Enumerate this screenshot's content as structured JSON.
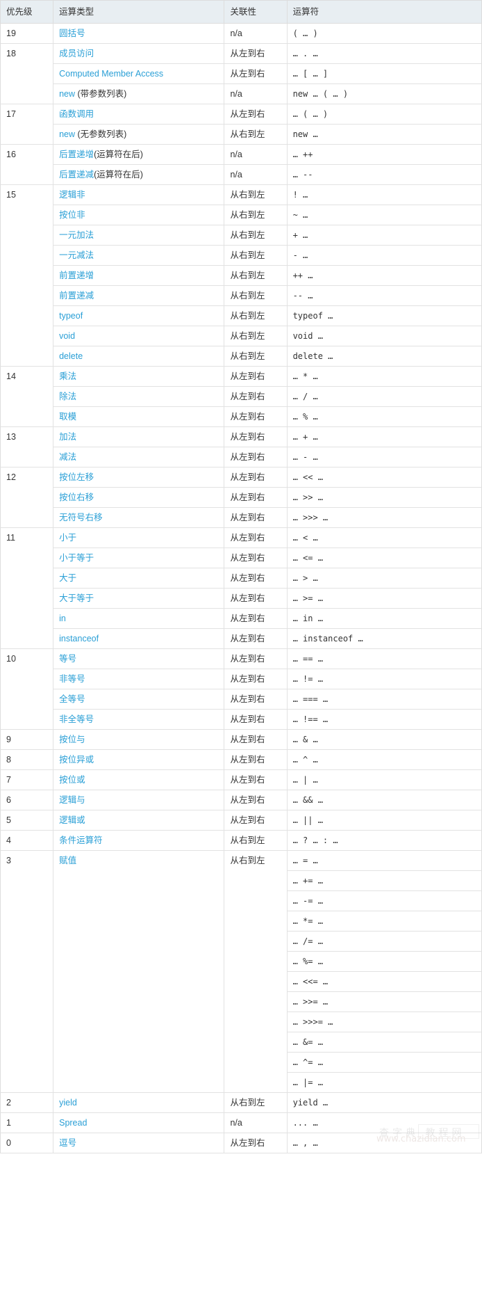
{
  "table": {
    "headers": [
      "优先级",
      "运算类型",
      "关联性",
      "运算符"
    ],
    "rows": [
      {
        "precedence": "19",
        "type_link": "圆括号",
        "type_plain": "",
        "assoc": "n/a",
        "operator": "( … )",
        "prec_rowspan": 1,
        "prec_show": true
      },
      {
        "precedence": "18",
        "type_link": "成员访问",
        "type_plain": "",
        "assoc": "从左到右",
        "operator": "… . …",
        "prec_rowspan": 3,
        "prec_show": true
      },
      {
        "precedence": "",
        "type_link": "Computed Member Access",
        "type_plain": "",
        "assoc": "从左到右",
        "operator": "… [ … ]",
        "prec_show": false
      },
      {
        "precedence": "",
        "type_link": "new",
        "type_plain": " (带参数列表)",
        "assoc": "n/a",
        "operator": "new … ( … )",
        "prec_show": false
      },
      {
        "precedence": "17",
        "type_link": "函数调用",
        "type_plain": "",
        "assoc": "从左到右",
        "operator": "… ( … )",
        "prec_rowspan": 2,
        "prec_show": true
      },
      {
        "precedence": "",
        "type_link": "new",
        "type_plain": " (无参数列表)",
        "assoc": "从右到左",
        "operator": "new …",
        "prec_show": false
      },
      {
        "precedence": "16",
        "type_link": "后置递增",
        "type_plain": "(运算符在后)",
        "assoc": "n/a",
        "operator": "… ++",
        "prec_rowspan": 2,
        "prec_show": true
      },
      {
        "precedence": "",
        "type_link": "后置递减",
        "type_plain": "(运算符在后)",
        "assoc": "n/a",
        "operator": "… --",
        "prec_show": false
      },
      {
        "precedence": "15",
        "type_link": "逻辑非",
        "type_plain": "",
        "assoc": "从右到左",
        "operator": "! …",
        "prec_rowspan": 9,
        "prec_show": true
      },
      {
        "precedence": "",
        "type_link": "按位非",
        "type_plain": "",
        "assoc": "从右到左",
        "operator": "~ …",
        "prec_show": false
      },
      {
        "precedence": "",
        "type_link": "一元加法",
        "type_plain": "",
        "assoc": "从右到左",
        "operator": "+ …",
        "prec_show": false
      },
      {
        "precedence": "",
        "type_link": "一元减法",
        "type_plain": "",
        "assoc": "从右到左",
        "operator": "- …",
        "prec_show": false
      },
      {
        "precedence": "",
        "type_link": "前置递增",
        "type_plain": "",
        "assoc": "从右到左",
        "operator": "++ …",
        "prec_show": false
      },
      {
        "precedence": "",
        "type_link": "前置递减",
        "type_plain": "",
        "assoc": "从右到左",
        "operator": "-- …",
        "prec_show": false
      },
      {
        "precedence": "",
        "type_link": "typeof",
        "type_plain": "",
        "assoc": "从右到左",
        "operator": "typeof …",
        "prec_show": false
      },
      {
        "precedence": "",
        "type_link": "void",
        "type_plain": "",
        "assoc": "从右到左",
        "operator": "void …",
        "prec_show": false
      },
      {
        "precedence": "",
        "type_link": "delete",
        "type_plain": "",
        "assoc": "从右到左",
        "operator": "delete …",
        "prec_show": false
      },
      {
        "precedence": "14",
        "type_link": "乘法",
        "type_plain": "",
        "assoc": "从左到右",
        "operator": "… * …",
        "prec_rowspan": 3,
        "prec_show": true
      },
      {
        "precedence": "",
        "type_link": "除法",
        "type_plain": "",
        "assoc": "从左到右",
        "operator": "… / …",
        "prec_show": false
      },
      {
        "precedence": "",
        "type_link": "取模",
        "type_plain": "",
        "assoc": "从左到右",
        "operator": "… % …",
        "prec_show": false
      },
      {
        "precedence": "13",
        "type_link": "加法",
        "type_plain": "",
        "assoc": "从左到右",
        "operator": "… + …",
        "prec_rowspan": 2,
        "prec_show": true
      },
      {
        "precedence": "",
        "type_link": "减法",
        "type_plain": "",
        "assoc": "从左到右",
        "operator": "… - …",
        "prec_show": false
      },
      {
        "precedence": "12",
        "type_link": "按位左移",
        "type_plain": "",
        "assoc": "从左到右",
        "operator": "… << …",
        "prec_rowspan": 3,
        "prec_show": true
      },
      {
        "precedence": "",
        "type_link": "按位右移",
        "type_plain": "",
        "assoc": "从左到右",
        "operator": "… >> …",
        "prec_show": false
      },
      {
        "precedence": "",
        "type_link": "无符号右移",
        "type_plain": "",
        "assoc": "从左到右",
        "operator": "… >>> …",
        "prec_show": false
      },
      {
        "precedence": "11",
        "type_link": "小于",
        "type_plain": "",
        "assoc": "从左到右",
        "operator": "… < …",
        "prec_rowspan": 6,
        "prec_show": true
      },
      {
        "precedence": "",
        "type_link": "小于等于",
        "type_plain": "",
        "assoc": "从左到右",
        "operator": "… <= …",
        "prec_show": false
      },
      {
        "precedence": "",
        "type_link": "大于",
        "type_plain": "",
        "assoc": "从左到右",
        "operator": "… > …",
        "prec_show": false
      },
      {
        "precedence": "",
        "type_link": "大于等于",
        "type_plain": "",
        "assoc": "从左到右",
        "operator": "… >= …",
        "prec_show": false
      },
      {
        "precedence": "",
        "type_link": "in",
        "type_plain": "",
        "assoc": "从左到右",
        "operator": "… in …",
        "prec_show": false
      },
      {
        "precedence": "",
        "type_link": "instanceof",
        "type_plain": "",
        "assoc": "从左到右",
        "operator": "… instanceof …",
        "prec_show": false
      },
      {
        "precedence": "10",
        "type_link": "等号",
        "type_plain": "",
        "assoc": "从左到右",
        "operator": "… == …",
        "prec_rowspan": 4,
        "prec_show": true
      },
      {
        "precedence": "",
        "type_link": "非等号",
        "type_plain": "",
        "assoc": "从左到右",
        "operator": "… != …",
        "prec_show": false
      },
      {
        "precedence": "",
        "type_link": "全等号",
        "type_plain": "",
        "assoc": "从左到右",
        "operator": "… === …",
        "prec_show": false
      },
      {
        "precedence": "",
        "type_link": "非全等号",
        "type_plain": "",
        "assoc": "从左到右",
        "operator": "… !== …",
        "prec_show": false
      },
      {
        "precedence": "9",
        "type_link": "按位与",
        "type_plain": "",
        "assoc": "从左到右",
        "operator": "… & …",
        "prec_rowspan": 1,
        "prec_show": true
      },
      {
        "precedence": "8",
        "type_link": "按位异或",
        "type_plain": "",
        "assoc": "从左到右",
        "operator": "… ^ …",
        "prec_rowspan": 1,
        "prec_show": true
      },
      {
        "precedence": "7",
        "type_link": "按位或",
        "type_plain": "",
        "assoc": "从左到右",
        "operator": "… | …",
        "prec_rowspan": 1,
        "prec_show": true
      },
      {
        "precedence": "6",
        "type_link": "逻辑与",
        "type_plain": "",
        "assoc": "从左到右",
        "operator": "… && …",
        "prec_rowspan": 1,
        "prec_show": true
      },
      {
        "precedence": "5",
        "type_link": "逻辑或",
        "type_plain": "",
        "assoc": "从左到右",
        "operator": "… || …",
        "prec_rowspan": 1,
        "prec_show": true
      },
      {
        "precedence": "4",
        "type_link": "条件运算符",
        "type_plain": "",
        "assoc": "从右到左",
        "operator": "… ? … : …",
        "prec_rowspan": 1,
        "prec_show": true
      }
    ],
    "assignment_group": {
      "precedence": "3",
      "type_link": "赋值",
      "assoc": "从右到左",
      "operators": [
        "… = …",
        "… += …",
        "… -= …",
        "… *= …",
        "… /= …",
        "… %= …",
        "… <<= …",
        "… >>= …",
        "… >>>= …",
        "… &= …",
        "… ^= …",
        "… |= …"
      ]
    },
    "tail_rows": [
      {
        "precedence": "2",
        "type_link": "yield",
        "type_plain": "",
        "assoc": "从右到左",
        "operator": "yield …"
      },
      {
        "precedence": "1",
        "type_link": "Spread",
        "type_plain": "",
        "assoc": "n/a",
        "operator": "... …"
      },
      {
        "precedence": "0",
        "type_link": "逗号",
        "type_plain": "",
        "assoc": "从左到右",
        "operator": "… , …"
      }
    ]
  },
  "watermark": {
    "line1": "查字典 教程网",
    "line2": "www.chazidian.com"
  },
  "colors": {
    "link": "#2a9fd6",
    "header_bg": "#e8eef2",
    "border": "#dddddd",
    "text": "#333333"
  }
}
